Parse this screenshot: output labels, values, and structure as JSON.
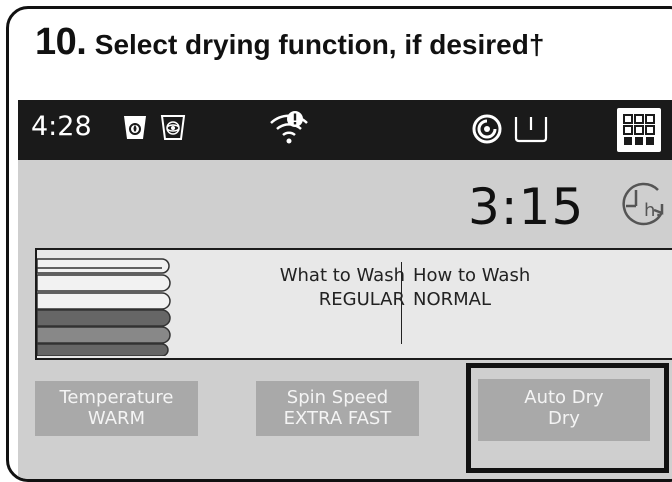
{
  "step": {
    "number": "10.",
    "text": "Select drying function, if desired†"
  },
  "status_bar": {
    "time": "4:28",
    "icons": [
      "detergent-icon",
      "softener-icon",
      "wifi-alert-icon",
      "remote-icon",
      "drum-icon",
      "menu-grid-icon"
    ]
  },
  "timer": {
    "remaining": "3:15",
    "icon": "delay-hours-icon"
  },
  "cycle": {
    "what_to_wash_label": "What to Wash",
    "what_to_wash_value": "REGULAR",
    "how_to_wash_label": "How to Wash",
    "how_to_wash_value": "NORMAL"
  },
  "buttons": [
    {
      "line1": "Temperature",
      "line2": "WARM"
    },
    {
      "line1": "Spin Speed",
      "line2": "EXTRA FAST"
    },
    {
      "line1": "Auto Dry",
      "line2": "Dry"
    }
  ],
  "colors": {
    "status_bar_bg": "#1a1a1a",
    "screen_bg": "#cfcfcf",
    "button_bg": "#a9a9a9",
    "highlight_border": "#111111"
  }
}
